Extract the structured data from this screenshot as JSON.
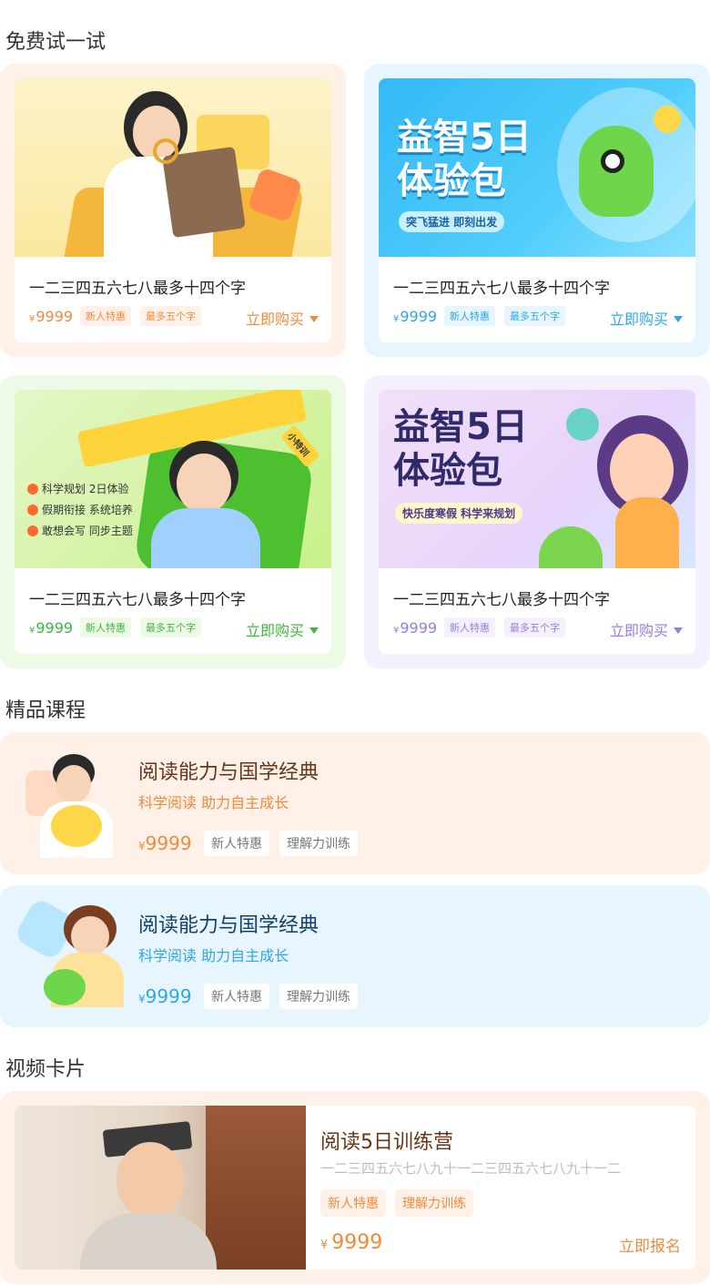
{
  "sections": {
    "trial": "免费试一试",
    "courses": "精品课程",
    "video": "视频卡片"
  },
  "trial_cards": [
    {
      "title": "一二三四五六七八最多十四个字",
      "currency": "¥",
      "price": "9999",
      "tag1": "新人特惠",
      "tag2": "最多五个字",
      "buy": "立即购买",
      "accent": "#f08a3c",
      "bg": "#fff1e8"
    },
    {
      "title": "一二三四五六七八最多十四个字",
      "currency": "¥",
      "price": "9999",
      "tag1": "新人特惠",
      "tag2": "最多五个字",
      "buy": "立即购买",
      "accent": "#2fa6ea",
      "bg": "#e7f6fe",
      "banner_line1": "益智5日",
      "banner_line2": "体验包",
      "banner_sub": "突飞猛进  即刻出发"
    },
    {
      "title": "一二三四五六七八最多十四个字",
      "currency": "¥",
      "price": "9999",
      "tag1": "新人特惠",
      "tag2": "最多五个字",
      "buy": "立即购买",
      "accent": "#3fb63f",
      "bg": "#edfbe6",
      "bullets": [
        "科学规划 2日体验",
        "假期衔接 系统培养",
        "敢想会写 同步主题"
      ],
      "pencil_tag": "小特训"
    },
    {
      "title": "一二三四五六七八最多十四个字",
      "currency": "¥",
      "price": "9999",
      "tag1": "新人特惠",
      "tag2": "最多五个字",
      "buy": "立即购买",
      "accent": "#9b7be0",
      "bg": "#f4f0fd",
      "banner_line1": "益智5日",
      "banner_line2": "体验包",
      "banner_sub": "快乐度寒假  科学来规划"
    }
  ],
  "courses": [
    {
      "title": "阅读能力与国学经典",
      "subtitle": "科学阅读  助力自主成长",
      "currency": "¥",
      "price": "9999",
      "tag1": "新人特惠",
      "tag2": "理解力训练",
      "bg": "#fff1e8",
      "title_color": "#6a3516",
      "accent": "#f08a3c"
    },
    {
      "title": "阅读能力与国学经典",
      "subtitle": "科学阅读  助力自主成长",
      "currency": "¥",
      "price": "9999",
      "tag1": "新人特惠",
      "tag2": "理解力训练",
      "bg": "#e7f6fe",
      "title_color": "#13406a",
      "accent": "#2fa6ea"
    }
  ],
  "video_card": {
    "title": "阅读5日训练营",
    "desc": "一二三四五六七八九十一二三四五六七八九十一二",
    "tag1": "新人特惠",
    "tag2": "理解力训练",
    "currency": "¥",
    "price": "9999",
    "action": "立即报名"
  }
}
